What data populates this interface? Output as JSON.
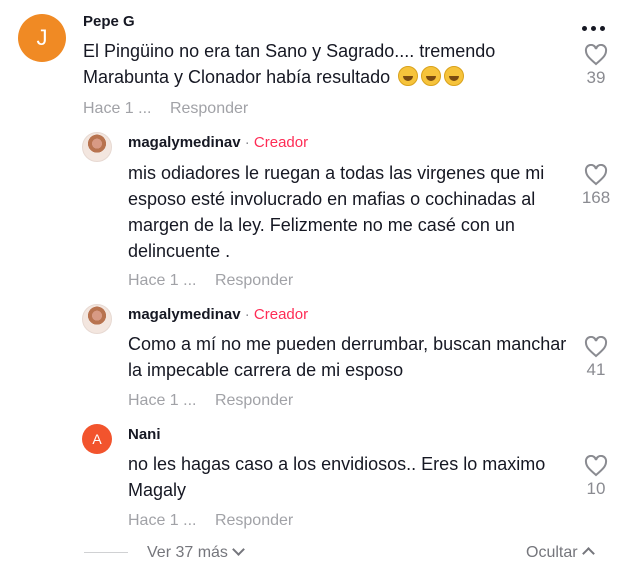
{
  "comments": [
    {
      "avatar_letter": "J",
      "avatar_color": "#f08a24",
      "username": "Pepe G",
      "text": "El Pingüino no era tan Sano y Sagrado.... tremendo Marabunta y Clonador había resultado",
      "emoji_icon": "grimacing-face-icon",
      "time": "Hace 1 ...",
      "reply_label": "Responder",
      "likes": "39"
    },
    {
      "username": "magalymedinav",
      "separator": "·",
      "badge": "Creador",
      "text": "mis odiadores le ruegan a todas las virgenes que mi esposo esté involucrado en mafias o cochinadas al margen de la ley. Felizmente no me casé con un delincuente .",
      "time": "Hace 1 ...",
      "reply_label": "Responder",
      "likes": "168"
    },
    {
      "username": "magalymedinav",
      "separator": "·",
      "badge": "Creador",
      "text": "Como a mí no me pueden derrumbar, buscan manchar la impecable carrera de mi esposo",
      "time": "Hace 1 ...",
      "reply_label": "Responder",
      "likes": "41"
    },
    {
      "avatar_letter": "A",
      "avatar_color": "#f2542d",
      "username": "Nani",
      "text": "no les hagas caso a los envidiosos.. Eres lo maximo Magaly",
      "time": "Hace 1 ...",
      "reply_label": "Responder",
      "likes": "10"
    }
  ],
  "footer": {
    "view_more": "Ver 37 más",
    "hide": "Ocultar"
  },
  "colors": {
    "creator_badge": "#fe2c55",
    "muted_text": "#a1a2a7"
  }
}
